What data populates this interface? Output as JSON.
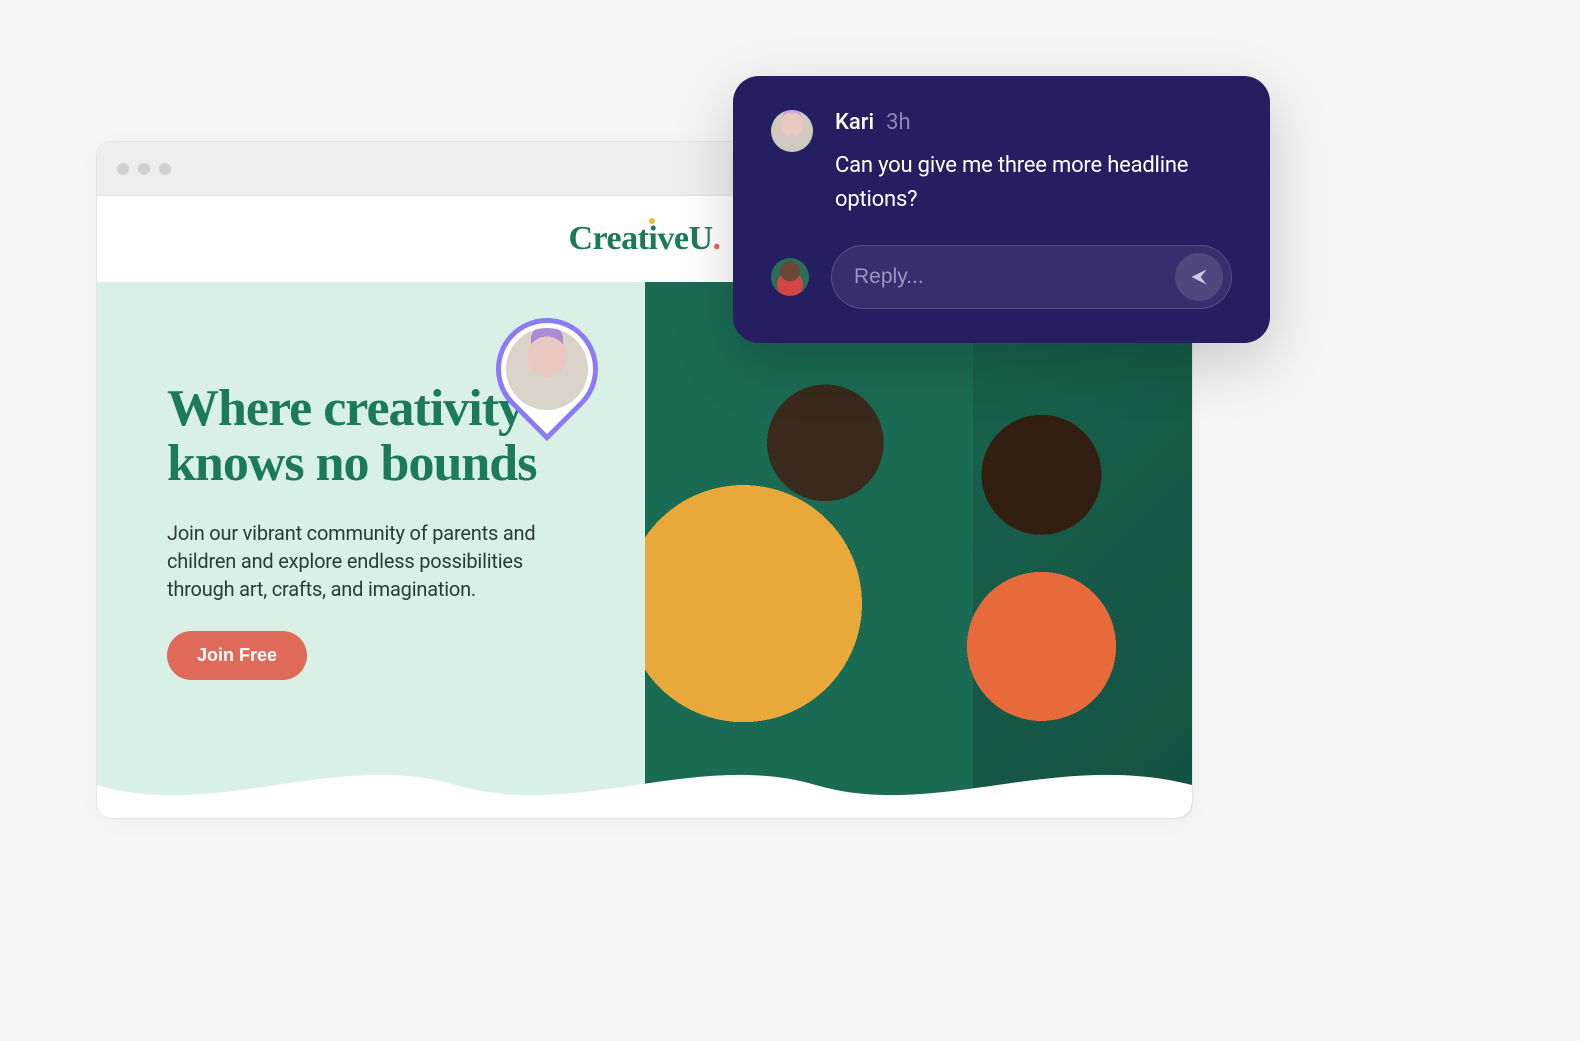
{
  "site": {
    "logo_text": "CreativeU",
    "logo_accent": "."
  },
  "hero": {
    "headline": "Where creativity knows no bounds",
    "sub": "Join our vibrant community of parents and children and explore endless possibilities through art, crafts, and imagination.",
    "cta_label": "Join Free"
  },
  "comment": {
    "author": "Kari",
    "timestamp": "3h",
    "text": "Can you give me three more headline options?",
    "reply_placeholder": "Reply..."
  },
  "colors": {
    "brand_green": "#1c7a5a",
    "mint_bg": "#d8f0e6",
    "cta_coral": "#e06a5a",
    "card_navy": "#251e61",
    "cursor_purple": "#8b7cf6"
  }
}
